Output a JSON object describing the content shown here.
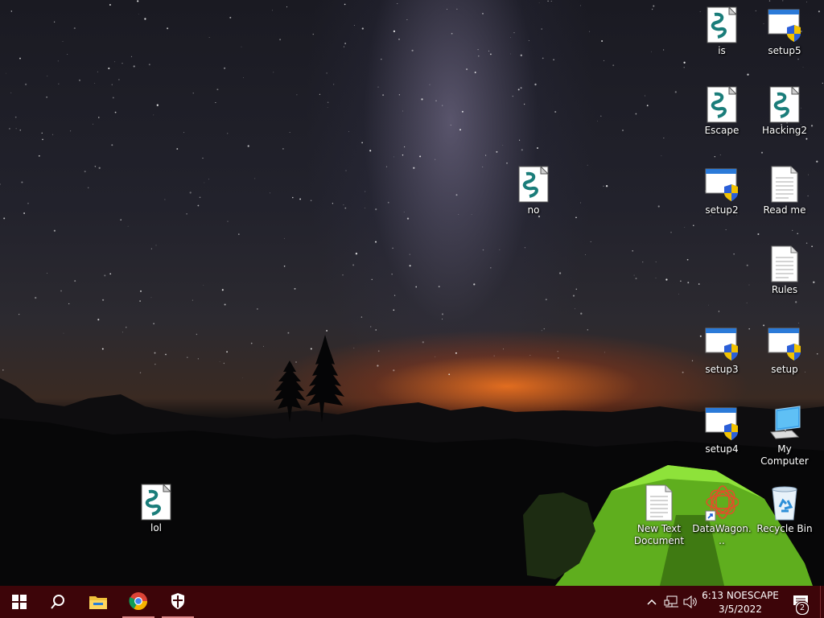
{
  "desktop": {
    "icons": [
      {
        "label": "is",
        "type": "script"
      },
      {
        "label": "setup5",
        "type": "installer"
      },
      {
        "label": "Escape",
        "type": "script"
      },
      {
        "label": "Hacking2",
        "type": "script"
      },
      {
        "label": "no",
        "type": "script"
      },
      {
        "label": "setup2",
        "type": "installer"
      },
      {
        "label": "Read me",
        "type": "text-document"
      },
      {
        "label": "Rules",
        "type": "text-document"
      },
      {
        "label": "setup3",
        "type": "installer"
      },
      {
        "label": "setup",
        "type": "installer"
      },
      {
        "label": "setup4",
        "type": "installer"
      },
      {
        "label": "My Computer",
        "type": "computer"
      },
      {
        "label": "lol",
        "type": "script"
      },
      {
        "label": "New Text Document",
        "type": "text-document"
      },
      {
        "label": "DataWagon...",
        "type": "shortcut"
      },
      {
        "label": "Recycle Bin",
        "type": "recycle-bin"
      }
    ]
  },
  "taskbar": {
    "color": "#3d0509",
    "buttons": [
      {
        "name": "start-button",
        "icon": "windows-logo-icon"
      },
      {
        "name": "search-button",
        "icon": "search-icon"
      },
      {
        "name": "file-explorer-button",
        "icon": "folder-icon"
      },
      {
        "name": "chrome-button",
        "icon": "chrome-icon"
      },
      {
        "name": "security-button",
        "icon": "shield-icon"
      }
    ],
    "tray": {
      "time": "6:13 NOESCAPE",
      "date": "3/5/2022",
      "notification_count": "2"
    }
  }
}
